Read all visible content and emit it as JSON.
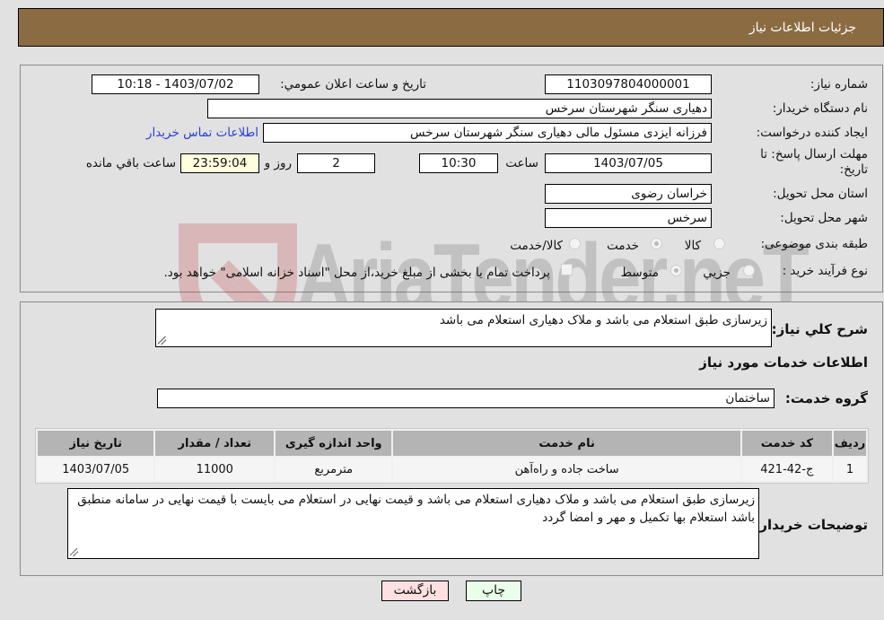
{
  "header": {
    "title": "جزئیات اطلاعات نیاز"
  },
  "form": {
    "need_number": {
      "label": "شماره نیاز:",
      "value": "1103097804000001"
    },
    "announce_datetime": {
      "label": "تاريخ و ساعت اعلان عمومي:",
      "value": "1403/07/02 - 10:18"
    },
    "buyer_org": {
      "label": "نام دستگاه خريدار:",
      "value": "دهیاری سنگر شهرستان سرخس"
    },
    "requester": {
      "label": "ايجاد کننده درخواست:",
      "value": "فرزانه ایزدی مسئول مالی دهیاری سنگر شهرستان سرخس"
    },
    "buyer_contact_link": "اطلاعات تماس خريدار",
    "deadline": {
      "label_line1": "مهلت ارسال پاسخ: تا",
      "label_line2": "تاريخ:",
      "date": "1403/07/05",
      "time_label": "ساعت",
      "time": "10:30",
      "days": "2",
      "days_label": "روز و",
      "remaining": "23:59:04",
      "remaining_label": "ساعت باقي مانده"
    },
    "province": {
      "label": "استان محل تحويل:",
      "value": "خراسان رضوی"
    },
    "city": {
      "label": "شهر محل تحويل:",
      "value": "سرخس"
    },
    "category": {
      "label": "طبقه بندی موضوعی:",
      "options": [
        "کالا",
        "خدمت",
        "کالا/خدمت"
      ],
      "selected": "خدمت"
    },
    "purchase_type": {
      "label": "نوع فرآيند خريد :",
      "options": [
        "جزيي",
        "متوسط"
      ],
      "selected": "متوسط",
      "treasury_note": "پرداخت تمام يا بخشی از مبلغ خريد،از محل \"اسناد خزانه اسلامی\" خواهد بود."
    }
  },
  "description": {
    "label": "شرح کلي نياز:",
    "value": "زیرسازی طبق استعلام می باشد و ملاک دهیاری استعلام می باشد"
  },
  "services_section_title": "اطلاعات خدمات مورد نياز",
  "service_group": {
    "label": "گروه خدمت:",
    "value": "ساختمان"
  },
  "table": {
    "headers": [
      "رديف",
      "کد خدمت",
      "نام خدمت",
      "واحد اندازه گيری",
      "تعداد / مقدار",
      "تاريخ نياز"
    ],
    "rows": [
      [
        "1",
        "ج-42-421",
        "ساخت جاده و راه‌آهن",
        "مترمربع",
        "11000",
        "1403/07/05"
      ]
    ]
  },
  "buyer_notes": {
    "label": "توضيحات خريدار:",
    "value": "زیرسازی طبق استعلام می باشد و ملاک دهیاری استعلام می باشد و قیمت نهایی در استعلام می بایست با قیمت نهایی در سامانه منطبق باشد استعلام بها تکمیل و مهر و امضا گردد"
  },
  "buttons": {
    "print": "چاپ",
    "back": "بازگشت"
  },
  "watermark": "AriaTender.neT",
  "colors": {
    "header_bg": "#8b6c42",
    "print_btn_bg": "#eaffea",
    "back_btn_bg": "#ffe0e0",
    "link": "#2a3fd6",
    "remaining_bg": "#ffffe0"
  }
}
